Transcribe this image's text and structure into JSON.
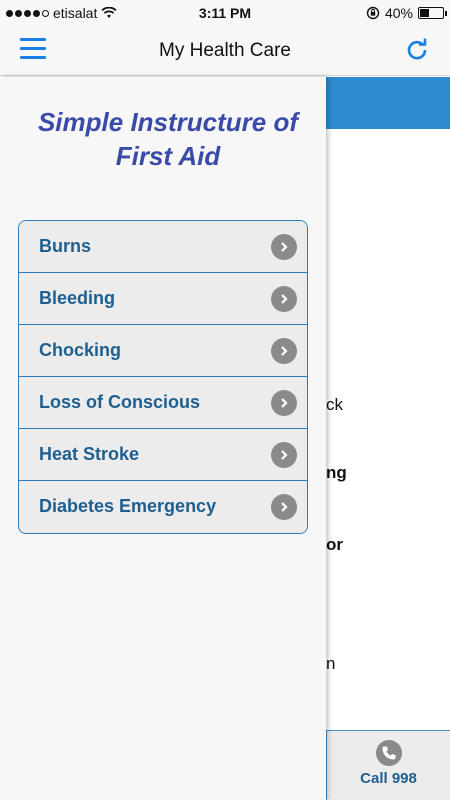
{
  "status": {
    "carrier": "etisalat",
    "signal_filled": 4,
    "signal_total": 5,
    "time": "3:11 PM",
    "battery_percent": "40%",
    "battery_level": 0.4
  },
  "nav": {
    "title": "My Health Care"
  },
  "drawer": {
    "title": "Simple Instructure of First Aid",
    "items": [
      {
        "label": "Burns"
      },
      {
        "label": "Bleeding"
      },
      {
        "label": "Chocking"
      },
      {
        "label": "Loss of Conscious"
      },
      {
        "label": "Heat Stroke"
      },
      {
        "label": "Diabetes Emergency"
      }
    ]
  },
  "background": {
    "fragments": [
      {
        "text": "ck",
        "bold": false
      },
      {
        "text": "ng",
        "bold": true
      },
      {
        "text": "or",
        "bold": true
      },
      {
        "text": "n",
        "bold": false
      }
    ],
    "call_label": "Call 998"
  },
  "colors": {
    "accent": "#1a7fe6",
    "header_blue": "#2f8bcf",
    "title_purple": "#3a4aa8",
    "item_text": "#1e5f8f",
    "border_blue": "#2b7bbf"
  }
}
